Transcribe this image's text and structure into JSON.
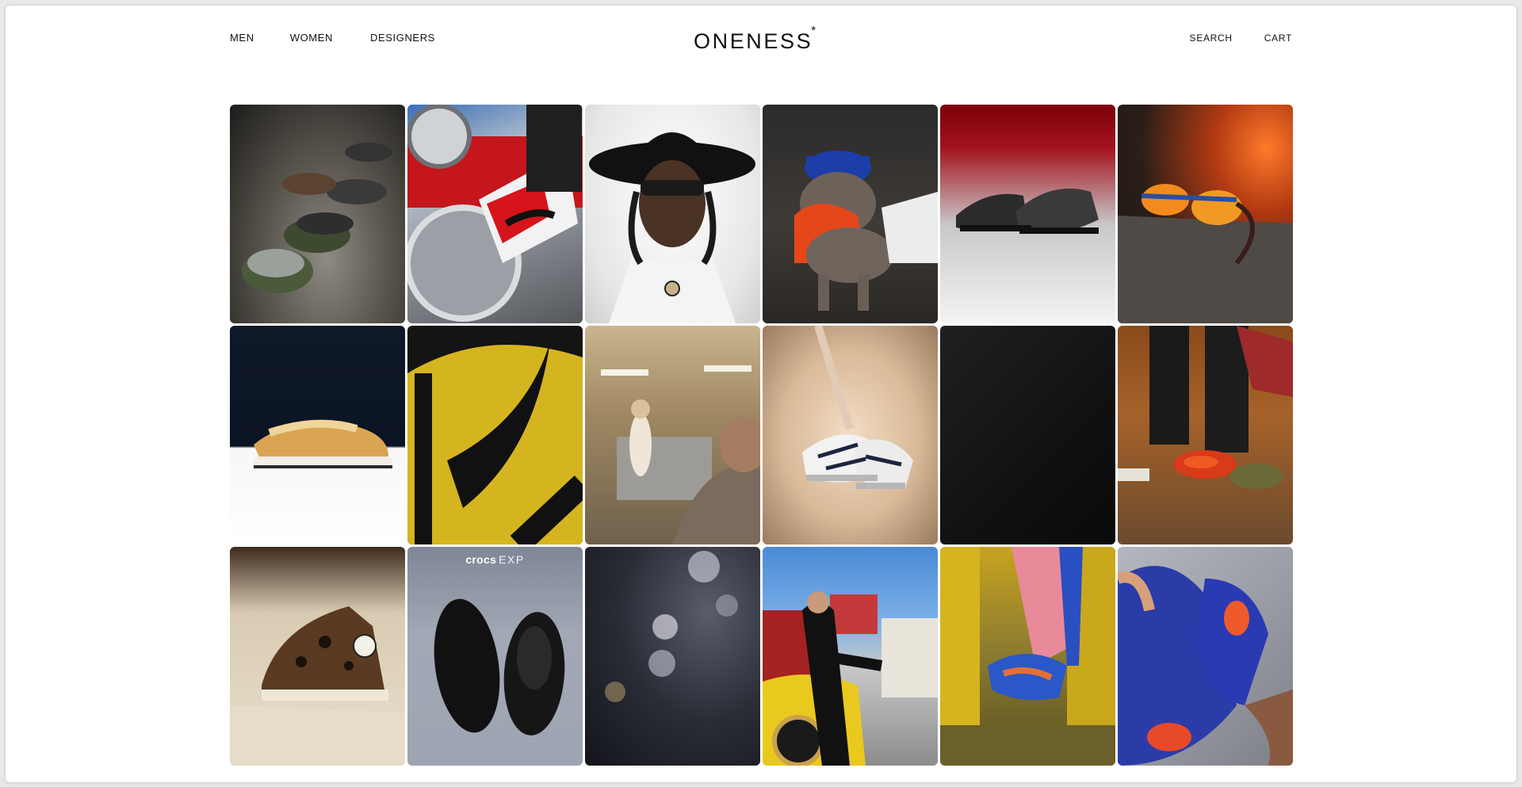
{
  "header": {
    "nav_left": [
      {
        "label": "MEN"
      },
      {
        "label": "WOMEN"
      },
      {
        "label": "DESIGNERS"
      }
    ],
    "logo": {
      "text": "ONENESS",
      "mark": "*"
    },
    "nav_right": [
      {
        "label": "SEARCH"
      },
      {
        "label": "CART"
      }
    ]
  },
  "tiles": [
    {
      "subject": "sneakers-group-on-concrete"
    },
    {
      "subject": "red-white-sneaker-on-car-bumper"
    },
    {
      "subject": "man-in-black-cowboy-hat"
    },
    {
      "subject": "bulldog-in-la-cap"
    },
    {
      "subject": "black-grey-sneakers-on-red"
    },
    {
      "subject": "sunglasses-on-rock-with-fire"
    },
    {
      "subject": "tan-sneaker-on-dark-blue"
    },
    {
      "subject": "yellow-black-sneaker-closeup"
    },
    {
      "subject": "person-in-kitchen"
    },
    {
      "subject": "white-sneakers-on-fur"
    },
    {
      "subject": "black-panel"
    },
    {
      "subject": "colorful-sneakers-on-leaves"
    },
    {
      "subject": "leopard-high-top-sneaker"
    },
    {
      "subject": "black-crocs-shoes",
      "label_bold": "crocs",
      "label_light": "EXP"
    },
    {
      "subject": "bokeh-lights"
    },
    {
      "subject": "man-leaning-on-yellow-car"
    },
    {
      "subject": "colorful-sneaker-on-yellow-bus-step"
    },
    {
      "subject": "blue-air-max-in-hands"
    }
  ],
  "colors": {
    "background": "#ffffff",
    "text": "#111111",
    "window_border": "#d6d6d6"
  }
}
